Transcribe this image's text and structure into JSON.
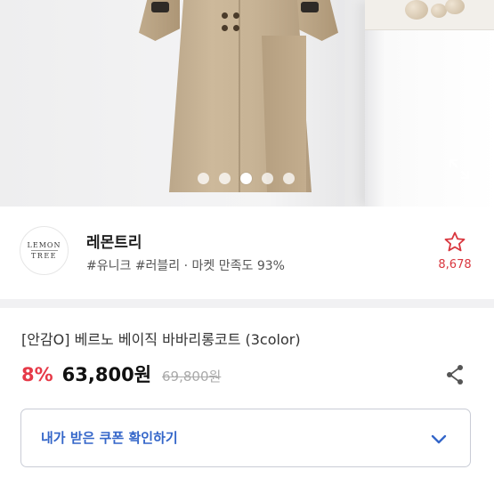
{
  "gallery": {
    "slide_count": 5,
    "active_slide": 3
  },
  "shop": {
    "logo_line1": "LEMON",
    "logo_line2": "TREE",
    "name": "레몬트리",
    "tags": "#유니크 #러블리 · 마켓 만족도 93%",
    "favorite_count": "8,678",
    "icons": {
      "favorite": "star-outline-icon"
    }
  },
  "product": {
    "title": "[안감O] 베르노 베이직 바바리롱코트 (3color)",
    "discount": "8%",
    "price": "63,800원",
    "original_price": "69,800원"
  },
  "coupon": {
    "label": "내가 받은 쿠폰 확인하기"
  },
  "colors": {
    "accent_red": "#e63a48",
    "coupon_blue": "#3466c9",
    "star_red": "#d9363e"
  }
}
